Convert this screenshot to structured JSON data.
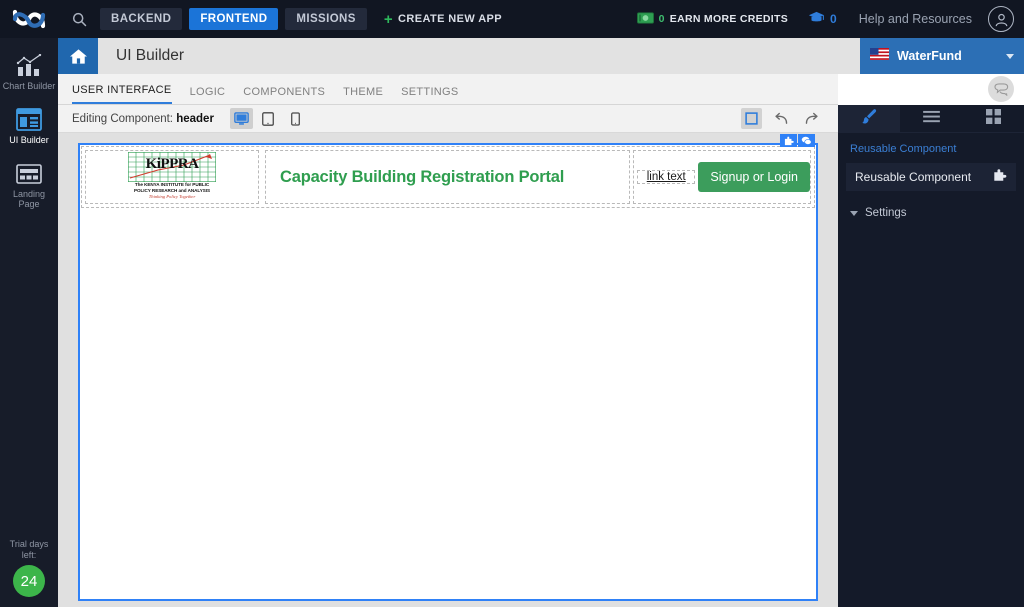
{
  "topbar": {
    "logo_name": "app-logo",
    "search_icon": "search-icon",
    "nav": [
      {
        "label": "BACKEND",
        "active": false
      },
      {
        "label": "FRONTEND",
        "active": true
      },
      {
        "label": "MISSIONS",
        "active": false
      }
    ],
    "create_app": "CREATE NEW APP",
    "credits_count": "0",
    "credits_label": "EARN MORE CREDITS",
    "learn_count": "0",
    "help_label": "Help and Resources",
    "avatar_name": "user-avatar"
  },
  "rail": {
    "items": [
      {
        "label": "Chart Builder",
        "icon": "bar-chart-icon",
        "active": false
      },
      {
        "label": "UI Builder",
        "icon": "ui-builder-icon",
        "active": true
      },
      {
        "label": "Landing Page",
        "icon": "landing-page-icon",
        "active": false
      }
    ],
    "trial_label_line1": "Trial days",
    "trial_label_line2": "left:",
    "trial_days": "24"
  },
  "subheader": {
    "home_icon": "home-icon",
    "title": "UI Builder",
    "org_name": "WaterFund",
    "org_flag": "us-flag-icon"
  },
  "tabs": [
    {
      "label": "USER INTERFACE",
      "active": true
    },
    {
      "label": "LOGIC",
      "active": false
    },
    {
      "label": "COMPONENTS",
      "active": false
    },
    {
      "label": "THEME",
      "active": false
    },
    {
      "label": "SETTINGS",
      "active": false
    }
  ],
  "toolbar": {
    "editing_prefix": "Editing Component:",
    "editing_component": "header",
    "devices": [
      {
        "name": "desktop-view-button",
        "active": true
      },
      {
        "name": "tablet-view-button",
        "active": false
      },
      {
        "name": "mobile-view-button",
        "active": false
      }
    ],
    "actions": [
      {
        "name": "select-box-button",
        "boxed": true
      },
      {
        "name": "undo-button",
        "boxed": false
      },
      {
        "name": "redo-button",
        "boxed": false
      }
    ]
  },
  "canvas": {
    "component_name": "header",
    "logo": {
      "wordmark": "KiPPRA",
      "subtitle_line1": "The KENYA INSTITUTE for PUBLIC",
      "subtitle_line2": "POLICY RESEARCH and ANALYSIS",
      "tagline": "Thinking Policy Together"
    },
    "portal_title": "Capacity Building Registration Portal",
    "link_text": "link text",
    "signup_button": "Signup or Login",
    "selection_tools": [
      {
        "name": "add-component-button",
        "icon": "puzzle-piece-icon"
      },
      {
        "name": "comment-button",
        "icon": "chat-bubble-icon"
      }
    ]
  },
  "right_panel": {
    "tabs": [
      {
        "name": "design-tab",
        "icon": "paintbrush-icon",
        "active": true
      },
      {
        "name": "layers-tab",
        "icon": "hamburger-icon",
        "active": false
      },
      {
        "name": "widgets-tab",
        "icon": "grid-icon",
        "active": false
      }
    ],
    "breadcrumb": "Reusable Component",
    "item_label": "Reusable Component",
    "item_icon": "puzzle-piece-icon",
    "section_label": "Settings"
  },
  "colors": {
    "accent_blue": "#2f81f7",
    "nav_active": "#1b74d8",
    "green_button": "#3c9d5c",
    "title_green": "#2f9e4f",
    "trial_green": "#3cb54a",
    "topbar_dark": "#111622",
    "panel_dark": "#141a29"
  }
}
